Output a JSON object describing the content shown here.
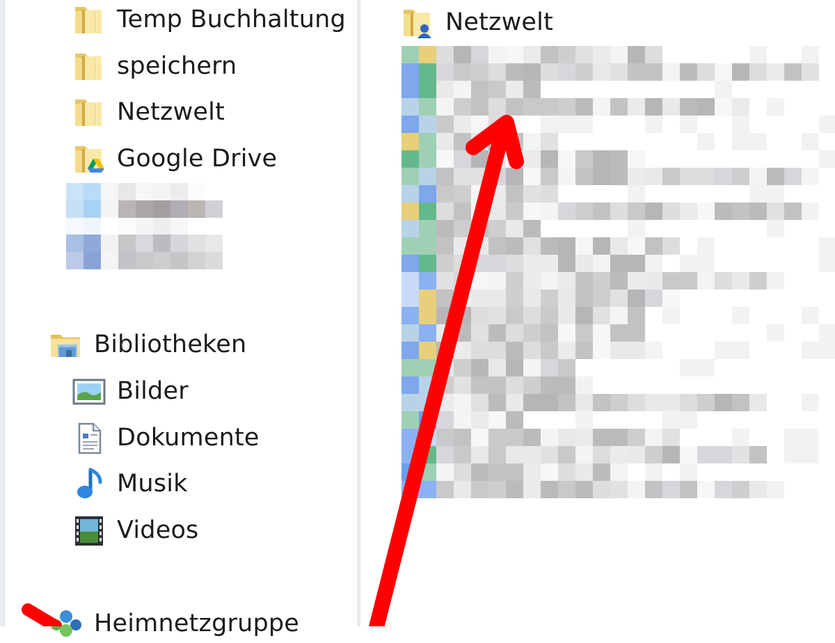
{
  "navigation": {
    "favorites_items": [
      {
        "label": "Temp Buchhaltung",
        "icon": "folder-icon"
      },
      {
        "label": "speichern",
        "icon": "folder-icon"
      },
      {
        "label": "Netzwelt",
        "icon": "folder-icon"
      },
      {
        "label": "Google Drive",
        "icon": "google-drive-folder-icon"
      }
    ],
    "libraries": {
      "label": "Bibliotheken",
      "icon": "libraries-icon",
      "items": [
        {
          "label": "Bilder",
          "icon": "pictures-icon"
        },
        {
          "label": "Dokumente",
          "icon": "documents-icon"
        },
        {
          "label": "Musik",
          "icon": "music-icon"
        },
        {
          "label": "Videos",
          "icon": "videos-icon"
        }
      ]
    },
    "homegroup": {
      "label": "Heimnetzgruppe",
      "icon": "homegroup-icon"
    }
  },
  "content": {
    "first_item": {
      "label": "Netzwelt",
      "icon": "user-folder-icon"
    }
  },
  "annotation": {
    "color": "#ff0000"
  }
}
